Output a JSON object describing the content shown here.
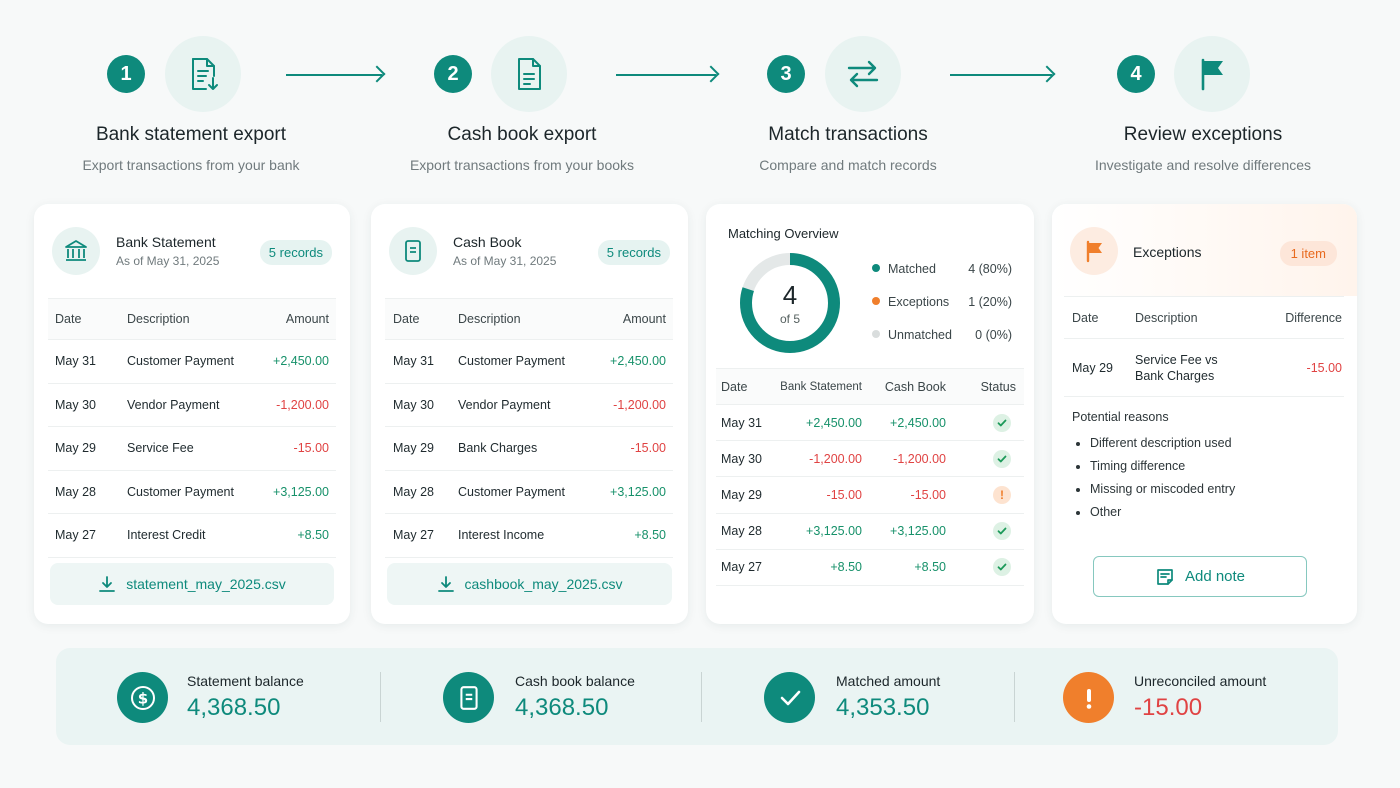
{
  "steps": [
    {
      "number": "1",
      "title": "Bank statement export",
      "subtitle": "Export transactions from your bank",
      "icon": "file-download-icon"
    },
    {
      "number": "2",
      "title": "Cash book export",
      "subtitle": "Export transactions from your books",
      "icon": "document-icon"
    },
    {
      "number": "3",
      "title": "Match transactions",
      "subtitle": "Compare and match records",
      "icon": "swap-arrows-icon"
    },
    {
      "number": "4",
      "title": "Review exceptions",
      "subtitle": "Investigate and resolve differences",
      "icon": "flag-icon"
    }
  ],
  "bank": {
    "title": "Bank Statement",
    "as_of": "As of May 31, 2025",
    "badge": "5 records",
    "columns": [
      "Date",
      "Description",
      "Amount"
    ],
    "rows": [
      {
        "date": "May 31",
        "description": "Customer Payment",
        "amount": "+2,450.00"
      },
      {
        "date": "May 30",
        "description": "Vendor Payment",
        "amount": "-1,200.00"
      },
      {
        "date": "May 29",
        "description": "Service Fee",
        "amount": "-15.00"
      },
      {
        "date": "May 28",
        "description": "Customer Payment",
        "amount": "+3,125.00"
      },
      {
        "date": "May 27",
        "description": "Interest Credit",
        "amount": "+8.50"
      }
    ],
    "file": "statement_may_2025.csv"
  },
  "cash": {
    "title": "Cash Book",
    "as_of": "As of May 31, 2025",
    "badge": "5 records",
    "columns": [
      "Date",
      "Description",
      "Amount"
    ],
    "rows": [
      {
        "date": "May 31",
        "description": "Customer Payment",
        "amount": "+2,450.00"
      },
      {
        "date": "May 30",
        "description": "Vendor Payment",
        "amount": "-1,200.00"
      },
      {
        "date": "May 29",
        "description": "Bank Charges",
        "amount": "-15.00"
      },
      {
        "date": "May 28",
        "description": "Customer Payment",
        "amount": "+3,125.00"
      },
      {
        "date": "May 27",
        "description": "Interest Income",
        "amount": "+8.50"
      }
    ],
    "file": "cashbook_may_2025.csv"
  },
  "overview": {
    "title": "Matching Overview",
    "donut_value": "4",
    "donut_sub": "of 5",
    "matched_fraction": 0.8,
    "legend": [
      {
        "label": "Matched",
        "value": "4 (80%)",
        "color": "#0e8a7c"
      },
      {
        "label": "Exceptions",
        "value": "1 (20%)",
        "color": "#f07f2c"
      },
      {
        "label": "Unmatched",
        "value": "0 (0%)",
        "color": "#d9dddd"
      }
    ],
    "columns": [
      "Date",
      "Bank Statement",
      "Cash Book",
      "Status"
    ],
    "rows": [
      {
        "date": "May 31",
        "bank": "+2,450.00",
        "cash": "+2,450.00",
        "status": "matched"
      },
      {
        "date": "May 30",
        "bank": "-1,200.00",
        "cash": "-1,200.00",
        "status": "matched"
      },
      {
        "date": "May 29",
        "bank": "-15.00",
        "cash": "-15.00",
        "status": "exception"
      },
      {
        "date": "May 28",
        "bank": "+3,125.00",
        "cash": "+3,125.00",
        "status": "matched"
      },
      {
        "date": "May 27",
        "bank": "+8.50",
        "cash": "+8.50",
        "status": "matched"
      }
    ]
  },
  "exceptions": {
    "title": "Exceptions",
    "badge": "1 item",
    "columns": [
      "Date",
      "Description",
      "Difference"
    ],
    "row": {
      "date": "May 29",
      "description_line1": "Service Fee vs",
      "description_line2": "Bank Charges",
      "difference": "-15.00"
    },
    "reasons_title": "Potential reasons",
    "reasons": [
      "Different description used",
      "Timing difference",
      "Missing or miscoded entry",
      "Other"
    ],
    "add_note": "Add note"
  },
  "summary": [
    {
      "label": "Statement balance",
      "value": "4,368.50",
      "icon": "dollar-coin-icon",
      "color": "#0e8a7c"
    },
    {
      "label": "Cash book balance",
      "value": "4,368.50",
      "icon": "ledger-icon",
      "color": "#0e8a7c"
    },
    {
      "label": "Matched amount",
      "value": "4,353.50",
      "icon": "check-icon",
      "color": "#0e8a7c"
    },
    {
      "label": "Unreconciled amount",
      "value": "-15.00",
      "icon": "exclamation-icon",
      "color": "#f07f2c"
    }
  ],
  "colors": {
    "accent": "#0e8a7c",
    "positive": "#17916a",
    "negative": "#e04343",
    "warning": "#f07f2c"
  }
}
